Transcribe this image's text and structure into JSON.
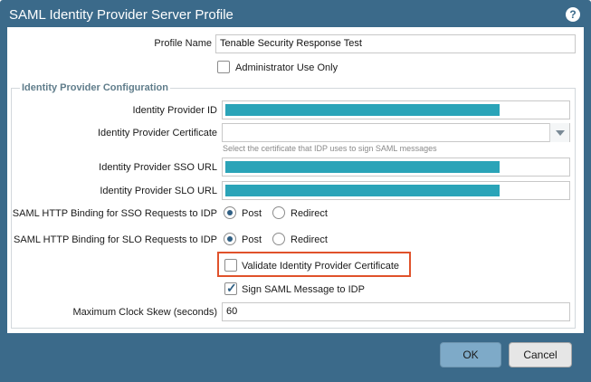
{
  "window": {
    "title": "SAML Identity Provider Server Profile",
    "help_glyph": "?"
  },
  "profile": {
    "name_label": "Profile Name",
    "name_value": "Tenable Security Response Test",
    "admin_only_label": "Administrator Use Only",
    "admin_only_checked": false
  },
  "idp": {
    "section_title": "Identity Provider Configuration",
    "id_label": "Identity Provider ID",
    "cert_label": "Identity Provider Certificate",
    "cert_hint": "Select the certificate that IDP uses to sign SAML messages",
    "sso_url_label": "Identity Provider SSO URL",
    "slo_url_label": "Identity Provider SLO URL",
    "sso_binding_label": "SAML HTTP Binding for SSO Requests to IDP",
    "slo_binding_label": "SAML HTTP Binding for SLO Requests to IDP",
    "post_label": "Post",
    "redirect_label": "Redirect",
    "sso_binding_selected": "Post",
    "slo_binding_selected": "Post",
    "validate_cert_label": "Validate Identity Provider Certificate",
    "validate_cert_checked": false,
    "sign_saml_label": "Sign SAML Message to IDP",
    "sign_saml_checked": true,
    "clock_skew_label": "Maximum Clock Skew (seconds)",
    "clock_skew_value": "60"
  },
  "footer": {
    "ok_label": "OK",
    "cancel_label": "Cancel"
  },
  "colors": {
    "header": "#3b6a8a",
    "redaction": "#2ba4b8",
    "highlight": "#e0522b"
  }
}
